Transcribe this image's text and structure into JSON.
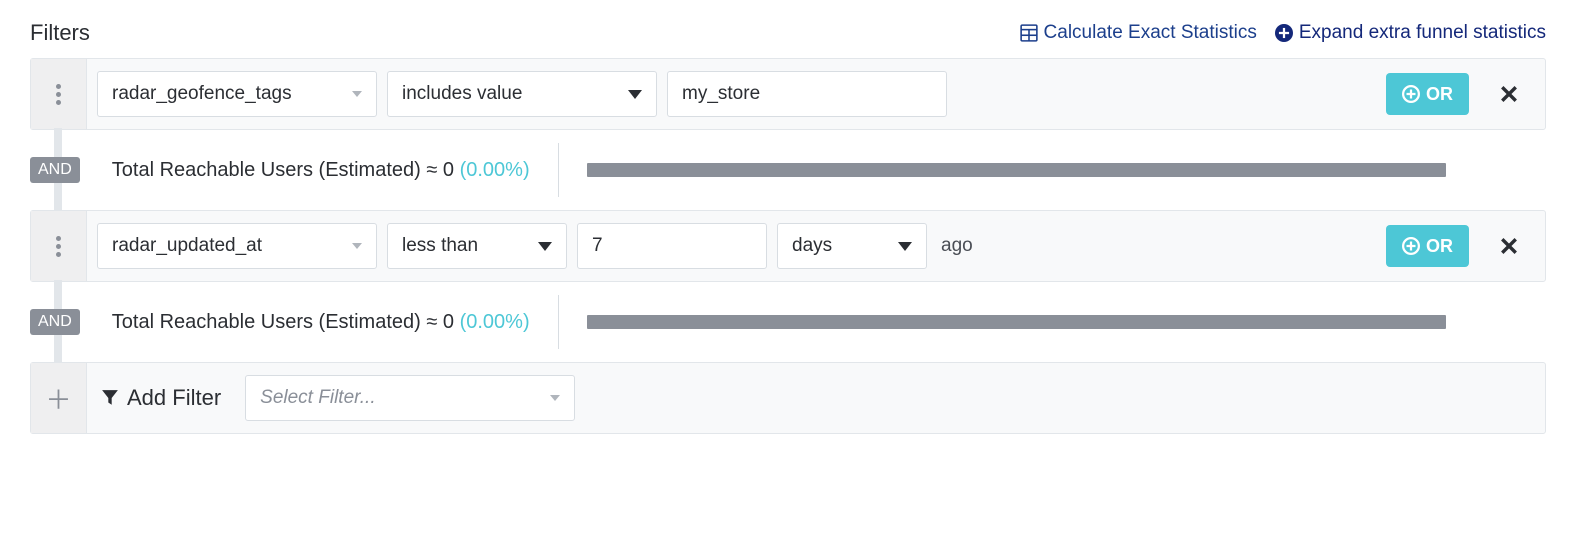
{
  "header": {
    "title": "Filters",
    "calc_link": "Calculate Exact Statistics",
    "expand_link": "Expand extra funnel statistics"
  },
  "filters": [
    {
      "field": "radar_geofence_tags",
      "operator": "includes value",
      "value": "my_store",
      "or_label": "OR"
    },
    {
      "field": "radar_updated_at",
      "operator": "less than",
      "value": "7",
      "unit": "days",
      "suffix": "ago",
      "or_label": "OR"
    }
  ],
  "stats": [
    {
      "and_label": "AND",
      "text": "Total Reachable Users (Estimated) ≈ 0",
      "pct": "(0.00%)"
    },
    {
      "and_label": "AND",
      "text": "Total Reachable Users (Estimated) ≈ 0",
      "pct": "(0.00%)"
    }
  ],
  "add_row": {
    "label": "Add Filter",
    "placeholder": "Select Filter..."
  }
}
